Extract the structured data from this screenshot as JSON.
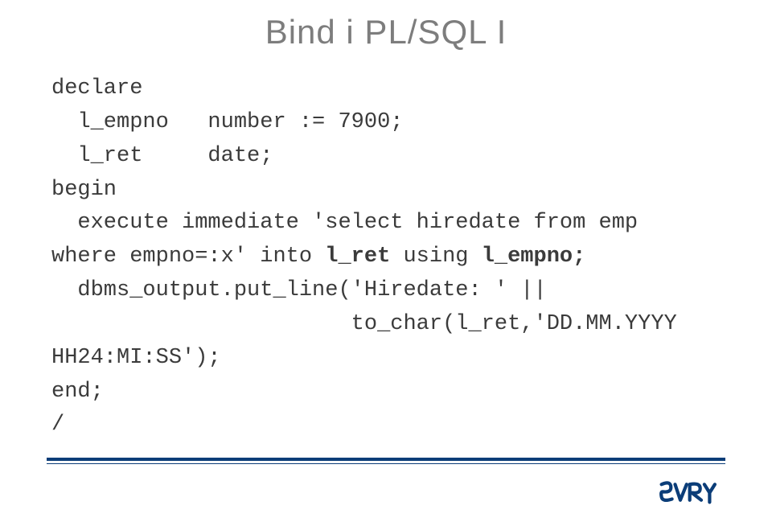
{
  "title": "Bind i PL/SQL I",
  "code": {
    "l1": "declare",
    "l2a": "  l_empno   number := 7900;",
    "l3": "  l_ret     date;",
    "l4": "begin",
    "l5": "  execute immediate 'select hiredate from emp",
    "l6a": "where empno=:x' into ",
    "l6b": "l_ret",
    "l6c": " using ",
    "l6d": "l_empno;",
    "l7": "  dbms_output.put_line('Hiredate: ' ||",
    "l8": "                       to_char(l_ret,'DD.MM.YYYY",
    "l9": "HH24:MI:SS');",
    "l10": "end;",
    "l11": "/"
  },
  "logo_text": "EVRY"
}
